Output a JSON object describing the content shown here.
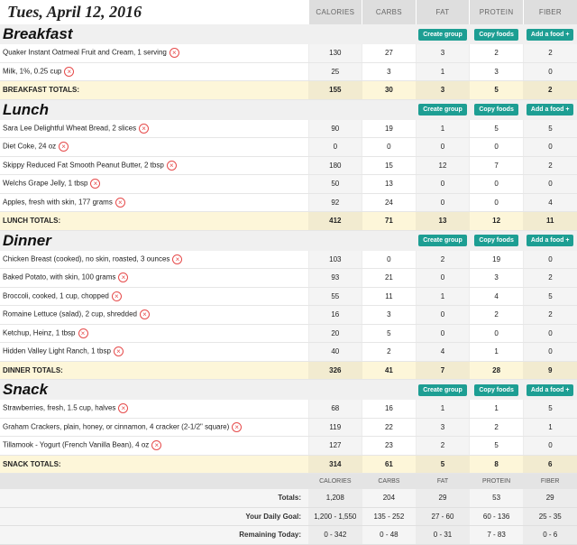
{
  "date": "Tues, April 12, 2016",
  "columns": [
    "CALORIES",
    "CARBS",
    "FAT",
    "PROTEIN",
    "FIBER"
  ],
  "buttons": {
    "create_group": "Create group",
    "copy_foods": "Copy foods",
    "add_food": "Add a food +"
  },
  "meals": [
    {
      "name": "Breakfast",
      "foods": [
        {
          "name": "Quaker Instant Oatmeal Fruit and Cream, 1 serving",
          "values": [
            "130",
            "27",
            "3",
            "2",
            "2"
          ]
        },
        {
          "name": "Milk, 1%, 0.25 cup",
          "values": [
            "25",
            "3",
            "1",
            "3",
            "0"
          ]
        }
      ],
      "totals_label": "BREAKFAST TOTALS:",
      "totals": [
        "155",
        "30",
        "3",
        "5",
        "2"
      ]
    },
    {
      "name": "Lunch",
      "foods": [
        {
          "name": "Sara Lee Delightful Wheat Bread, 2 slices",
          "values": [
            "90",
            "19",
            "1",
            "5",
            "5"
          ]
        },
        {
          "name": "Diet Coke, 24 oz",
          "values": [
            "0",
            "0",
            "0",
            "0",
            "0"
          ]
        },
        {
          "name": "Skippy Reduced Fat Smooth Peanut Butter, 2 tbsp",
          "values": [
            "180",
            "15",
            "12",
            "7",
            "2"
          ]
        },
        {
          "name": "Welchs Grape Jelly, 1 tbsp",
          "values": [
            "50",
            "13",
            "0",
            "0",
            "0"
          ]
        },
        {
          "name": "Apples, fresh with skin, 177 grams",
          "values": [
            "92",
            "24",
            "0",
            "0",
            "4"
          ]
        }
      ],
      "totals_label": "LUNCH TOTALS:",
      "totals": [
        "412",
        "71",
        "13",
        "12",
        "11"
      ]
    },
    {
      "name": "Dinner",
      "foods": [
        {
          "name": "Chicken Breast (cooked), no skin, roasted, 3 ounces",
          "values": [
            "103",
            "0",
            "2",
            "19",
            "0"
          ]
        },
        {
          "name": "Baked Potato, with skin, 100 grams",
          "values": [
            "93",
            "21",
            "0",
            "3",
            "2"
          ]
        },
        {
          "name": "Broccoli, cooked, 1 cup, chopped",
          "values": [
            "55",
            "11",
            "1",
            "4",
            "5"
          ]
        },
        {
          "name": "Romaine Lettuce (salad), 2 cup, shredded",
          "values": [
            "16",
            "3",
            "0",
            "2",
            "2"
          ]
        },
        {
          "name": "Ketchup, Heinz, 1 tbsp",
          "values": [
            "20",
            "5",
            "0",
            "0",
            "0"
          ]
        },
        {
          "name": "Hidden Valley Light Ranch, 1 tbsp",
          "values": [
            "40",
            "2",
            "4",
            "1",
            "0"
          ]
        }
      ],
      "totals_label": "DINNER TOTALS:",
      "totals": [
        "326",
        "41",
        "7",
        "28",
        "9"
      ]
    },
    {
      "name": "Snack",
      "foods": [
        {
          "name": "Strawberries, fresh, 1.5 cup, halves",
          "values": [
            "68",
            "16",
            "1",
            "1",
            "5"
          ]
        },
        {
          "name": "Graham Crackers, plain, honey, or cinnamon, 4 cracker (2-1/2\" square)",
          "values": [
            "119",
            "22",
            "3",
            "2",
            "1"
          ]
        },
        {
          "name": "Tillamook - Yogurt (French Vanilla Bean), 4 oz",
          "values": [
            "127",
            "23",
            "2",
            "5",
            "0"
          ]
        }
      ],
      "totals_label": "SNACK TOTALS:",
      "totals": [
        "314",
        "61",
        "5",
        "8",
        "6"
      ]
    }
  ],
  "summary": {
    "columns": [
      "CALORIES",
      "CARBS",
      "FAT",
      "PROTEIN",
      "FIBER"
    ],
    "rows": [
      {
        "label": "Totals:",
        "values": [
          "1,208",
          "204",
          "29",
          "53",
          "29"
        ]
      },
      {
        "label": "Your Daily Goal:",
        "values": [
          "1,200 - 1,550",
          "135 - 252",
          "27 - 60",
          "60 - 136",
          "25 - 35"
        ]
      },
      {
        "label": "Remaining Today:",
        "values": [
          "0 - 342",
          "0 - 48",
          "0 - 31",
          "7 - 83",
          "0 - 6"
        ]
      }
    ]
  },
  "icons": {
    "remove": "remove-circle-x-icon"
  },
  "colors": {
    "button": "#1d9e93",
    "remove_icon": "#e64b4b",
    "totals_row": "#fdf6d9",
    "header": "#dedede"
  }
}
